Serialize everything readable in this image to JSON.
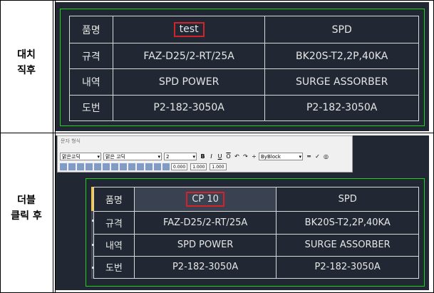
{
  "side_labels": {
    "top": [
      "대치",
      "직후"
    ],
    "bottom": [
      "더블",
      "클릭 후"
    ]
  },
  "table_before": {
    "rows": [
      {
        "header": "품명",
        "col1": "test",
        "col2": "SPD"
      },
      {
        "header": "규격",
        "col1": "FAZ-D25/2-RT/25A",
        "col2": "BK20S-T2,2P,40KA"
      },
      {
        "header": "내역",
        "col1": "SPD POWER",
        "col2": "SURGE ASSORBER"
      },
      {
        "header": "도번",
        "col1": "P2-182-3050A",
        "col2": "P2-182-3050A"
      }
    ]
  },
  "table_after": {
    "rows": [
      {
        "header": "품명",
        "col1": "CP 10",
        "col2": "SPD"
      },
      {
        "header": "규격",
        "col1": "FAZ-D25/2-RT/25A",
        "col2": "BK20S-T2,2P,40KA"
      },
      {
        "header": "내역",
        "col1": "SPD POWER",
        "col2": "SURGE ASSORBER"
      },
      {
        "header": "도번",
        "col1": "P2-182-3050A",
        "col2": "P2-182-3050A"
      }
    ]
  },
  "toolbar": {
    "title": "문자 형식",
    "style_combo": "맑은고딕",
    "font_combo": "맑은 고딕",
    "height_combo": "2",
    "bold": "B",
    "italic": "I",
    "underline": "U",
    "overline": "O",
    "color_combo": "ByBlock",
    "oblique": "0.000",
    "tracking": "1.000",
    "width": "1.000"
  },
  "colors": {
    "cad_bg": "#212833",
    "frame": "#1fd11f",
    "highlight": "#d2222a"
  }
}
